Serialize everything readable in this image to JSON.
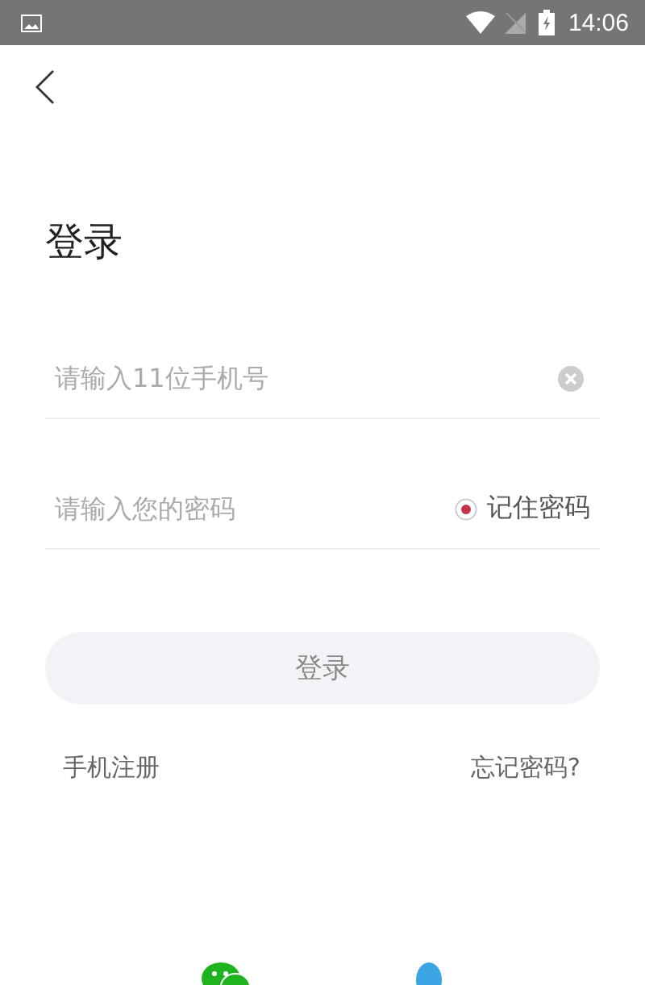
{
  "status_bar": {
    "time": "14:06"
  },
  "title": "登录",
  "phone_field": {
    "placeholder": "请输入11位手机号"
  },
  "password_field": {
    "placeholder": "请输入您的密码"
  },
  "remember_password": {
    "label": "记住密码",
    "checked": true
  },
  "login_button": {
    "label": "登录"
  },
  "links": [
    {
      "label": "手机注册"
    },
    {
      "label": "忘记密码?"
    }
  ]
}
